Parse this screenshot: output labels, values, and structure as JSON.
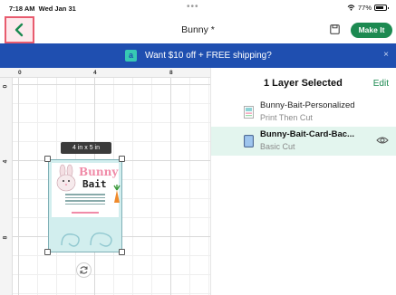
{
  "status": {
    "time": "7:18 AM",
    "date": "Wed Jan 31",
    "multitask": "•••",
    "battery": "77%"
  },
  "header": {
    "title": "Bunny *",
    "make_it": "Make It"
  },
  "banner": {
    "icon_letter": "a",
    "text": "Want $10 off + FREE shipping?",
    "close": "×"
  },
  "ruler": {
    "top": [
      "0",
      "4",
      "8"
    ],
    "left": [
      "0",
      "4",
      "8"
    ]
  },
  "canvas": {
    "size_label": "4 in x 5 in",
    "card": {
      "title_line1": "Bunny",
      "title_line2": "Bait"
    }
  },
  "panel": {
    "title": "1 Layer Selected",
    "edit": "Edit",
    "layers": [
      {
        "name": "Bunny-Bait-Personalized",
        "type": "Print Then Cut",
        "selected": false
      },
      {
        "name": "Bunny-Bait-Card-Bac...",
        "type": "Basic Cut",
        "selected": true
      }
    ]
  },
  "colors": {
    "accent": "#1c8a51",
    "banner": "#1f4fb0",
    "highlight": "#e85b6e",
    "selected_row": "#e3f5ee"
  }
}
